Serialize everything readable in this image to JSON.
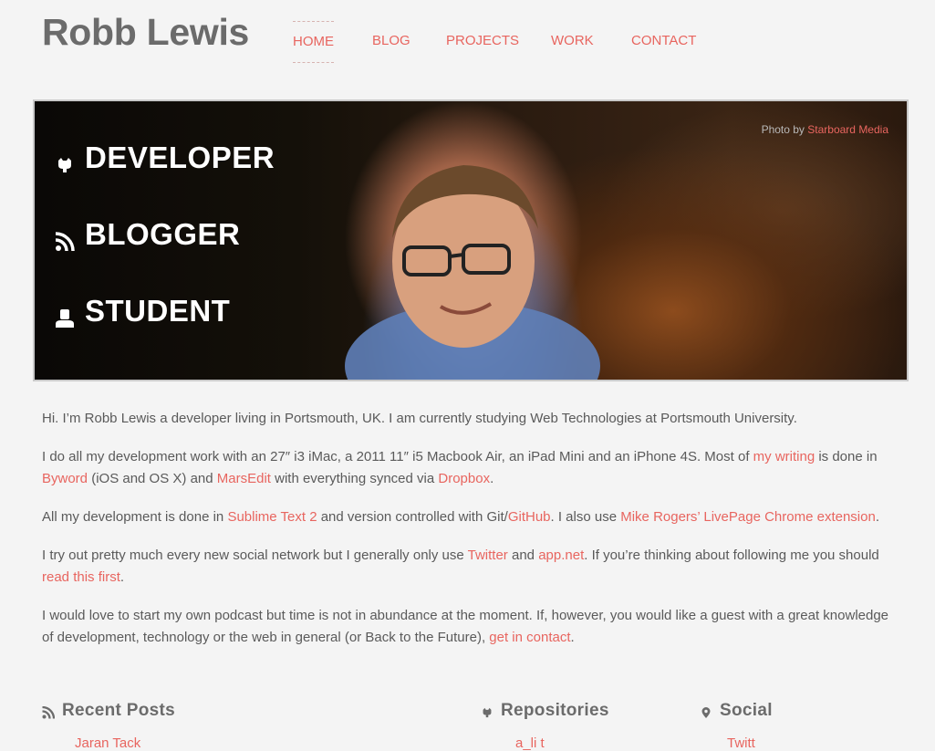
{
  "site": {
    "title": "Robb Lewis"
  },
  "nav": {
    "items": [
      {
        "label": "HOME",
        "active": true
      },
      {
        "label": "BLOG",
        "active": false
      },
      {
        "label": "PROJECTS",
        "active": false
      },
      {
        "label": "WORK",
        "active": false
      },
      {
        "label": "CONTACT",
        "active": false
      }
    ]
  },
  "hero": {
    "roles": [
      {
        "label": "DEVELOPER",
        "icon": "github-octocat-icon"
      },
      {
        "label": "BLOGGER",
        "icon": "rss-icon"
      },
      {
        "label": "STUDENT",
        "icon": "user-icon"
      }
    ],
    "credit_prefix": "Photo by",
    "credit_link": "Starboard Media"
  },
  "intro": {
    "p1": "Hi. I’m Robb Lewis a developer living in Portsmouth, UK. I am currently studying Web Technologies at Portsmouth University.",
    "p2": {
      "t1": "I do all my development work with an 27″ i3 iMac, a 2011 11″ i5 Macbook Air, an iPad Mini and an iPhone 4S. Most of ",
      "link1": "my writing",
      "t2": " is done in ",
      "link2": "Byword",
      "t3": " (iOS and OS X) and ",
      "link3": "MarsEdit",
      "t4": " with everything synced via ",
      "link4": "Dropbox",
      "t5": "."
    },
    "p3": {
      "t1": "All my development is done in ",
      "link1": "Sublime Text 2",
      "t2": " and version controlled with Git/",
      "link2": "GitHub",
      "t3": ". I also use ",
      "link3": "Mike Rogers’ LivePage Chrome extension",
      "t4": "."
    },
    "p4": {
      "t1": "I try out pretty much every new social network but I generally only use  ",
      "link1": "Twitter",
      "t2": " and ",
      "link2": "app.net",
      "t3": ". If you’re thinking about following me you should ",
      "link3": "read this first",
      "t4": "."
    },
    "p5": {
      "t1": "I would love to start my own podcast but time is not in abundance at the moment. If, however, you would like a guest with a great knowledge of development, technology or the web in general (or Back to the Future), ",
      "link1": "get in contact",
      "t2": "."
    }
  },
  "sections": {
    "recent_posts": {
      "title": "Recent Posts",
      "icon": "rss-icon",
      "first_item": "Jaran Tack"
    },
    "repositories": {
      "title": "Repositories",
      "icon": "github-octocat-icon",
      "first_item": "a_li t"
    },
    "social": {
      "title": "Social",
      "icon": "location-pin-icon",
      "first_item": "Twitt"
    }
  },
  "colors": {
    "accent": "#e8655f",
    "text": "#5a5a5a",
    "heading": "#6b6b6b",
    "background": "#f4f4f4"
  }
}
